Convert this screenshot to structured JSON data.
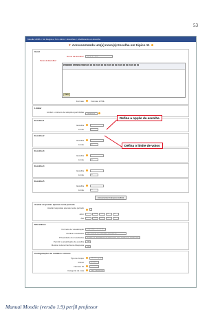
{
  "page_number": "53",
  "caption": "Manual Moodle (versão 1.9) perfil professor",
  "navbar": "Moodle UFBA > Sic Regina e Tom Jobim > Escolhas > Modificando um Escolha",
  "form_title": "Acrescentando um(a) novo(a) Escolha em tópico 11",
  "sections": {
    "geral": "Geral",
    "limitar": "Limitar",
    "escolha1": "Escolha 1",
    "escolha2": "Escolha 2",
    "escolha3": "Escolha 3",
    "escolha4": "Escolha 4",
    "escolha5": "Escolha 5",
    "respostas": "Aceitar respostas apenas neste período",
    "misc": "Miscelânea",
    "modulo": "Configurações de módulos comuns"
  },
  "fields": {
    "nome_label": "Nome da Escolha*",
    "nome_value": "Insira um valor",
    "texto_label": "Texto da Escolha*",
    "editor_font": "Trebuchet",
    "editor_size": "1 (8 pt)",
    "editor_lang": "Lang",
    "editor_path": "Path:",
    "formato_label": "Formato",
    "formato_value": "Formato HTML",
    "limitar_label": "Limitar o número de soluções permitidas",
    "limitar_value": "Desabilitar",
    "escolha_label": "Escolha",
    "limite_label": "Limite",
    "limite_value": "0",
    "respostas_label": "Aceitar respostas apenas neste período",
    "abrir_label": "Abrir",
    "ate_label": "Até",
    "date_values": [
      "1",
      "Setembro",
      "2009",
      "14",
      "55"
    ],
    "visualizacao_label": "Formato de visualização",
    "visualizacao_value": "Disposição horizontal",
    "publicar_label": "Publicar resultados",
    "publicar_value": "Não mostrar os resultados aos alunos",
    "privacidade_label": "Privacidade dos resultados",
    "privacidade_value": "Mostrar os resultados anonimamente, sem mostrar os nomes dos alunos",
    "atualizacao_label": "Permitir a atualização da escolha",
    "atualizacao_value": "Não",
    "coluna_label": "Mostrar coluna Nenhuma Resposta",
    "coluna_value": "Não",
    "grupo_label": "Tipo de Grupo",
    "grupo_value": "Nenhum grupo",
    "visivel_label": "Visível",
    "visivel_value": "Mostrar",
    "id_label": "Número ID",
    "categoria_label": "Categoria da nota",
    "categoria_value": "Não Classificados"
  },
  "callouts": {
    "escolha": "Defina a opção da escolha",
    "limite": "Defina o limite de votos"
  },
  "submit_label": "Acrescentar Campos da lista"
}
